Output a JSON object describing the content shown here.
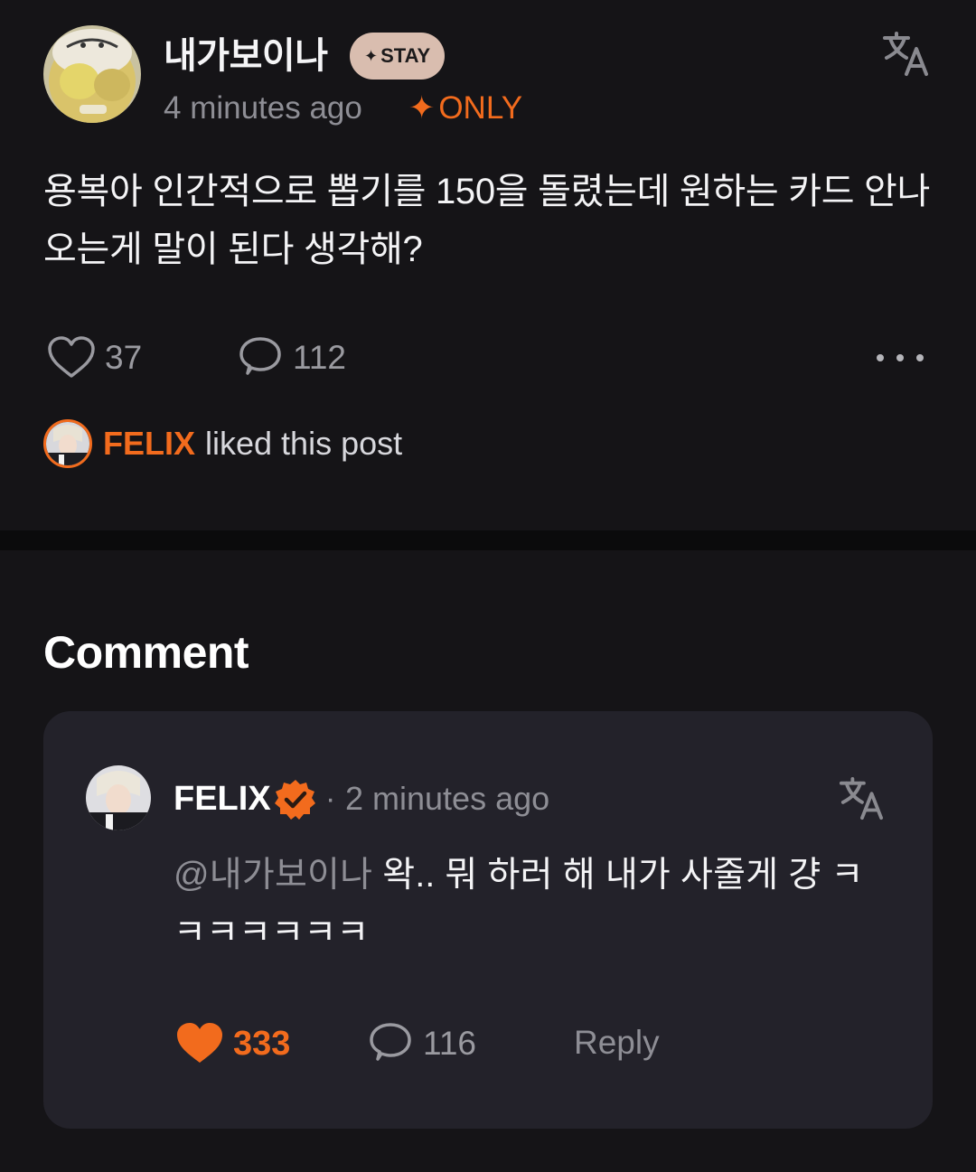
{
  "post": {
    "author_name": "내가보이나",
    "author_badge": "STAY",
    "time_ago": "4 minutes ago",
    "visibility_label": "ONLY",
    "body": "용복아 인간적으로 뽑기를 150을 돌렸는데 원하는 카드 안나오는게 말이 된다 생각해?",
    "like_count": "37",
    "comment_count": "112",
    "liked_by_name": "FELIX",
    "liked_by_text": "liked this post"
  },
  "comments_section": {
    "heading": "Comment",
    "items": [
      {
        "author_name": "FELIX",
        "verified": true,
        "separator": "·",
        "time_ago": "2 minutes ago",
        "mention": "@내가보이나",
        "text": " 왁.. 뭐 하러 해 내가 사줄게 걍 ㅋㅋㅋㅋㅋㅋㅋ",
        "like_count": "333",
        "liked": true,
        "reply_count": "116",
        "reply_label": "Reply"
      }
    ]
  },
  "icons": {
    "translate": "translate-icon",
    "heart": "heart-icon",
    "comment": "comment-bubble-icon",
    "more": "more-horizontal-icon",
    "verified": "verified-badge-icon",
    "star": "sparkle-star-icon"
  },
  "colors": {
    "background": "#151417",
    "card": "#23222a",
    "accent": "#f26b1d",
    "muted": "#8e8e95",
    "badge_bg": "#d9bdaf"
  }
}
